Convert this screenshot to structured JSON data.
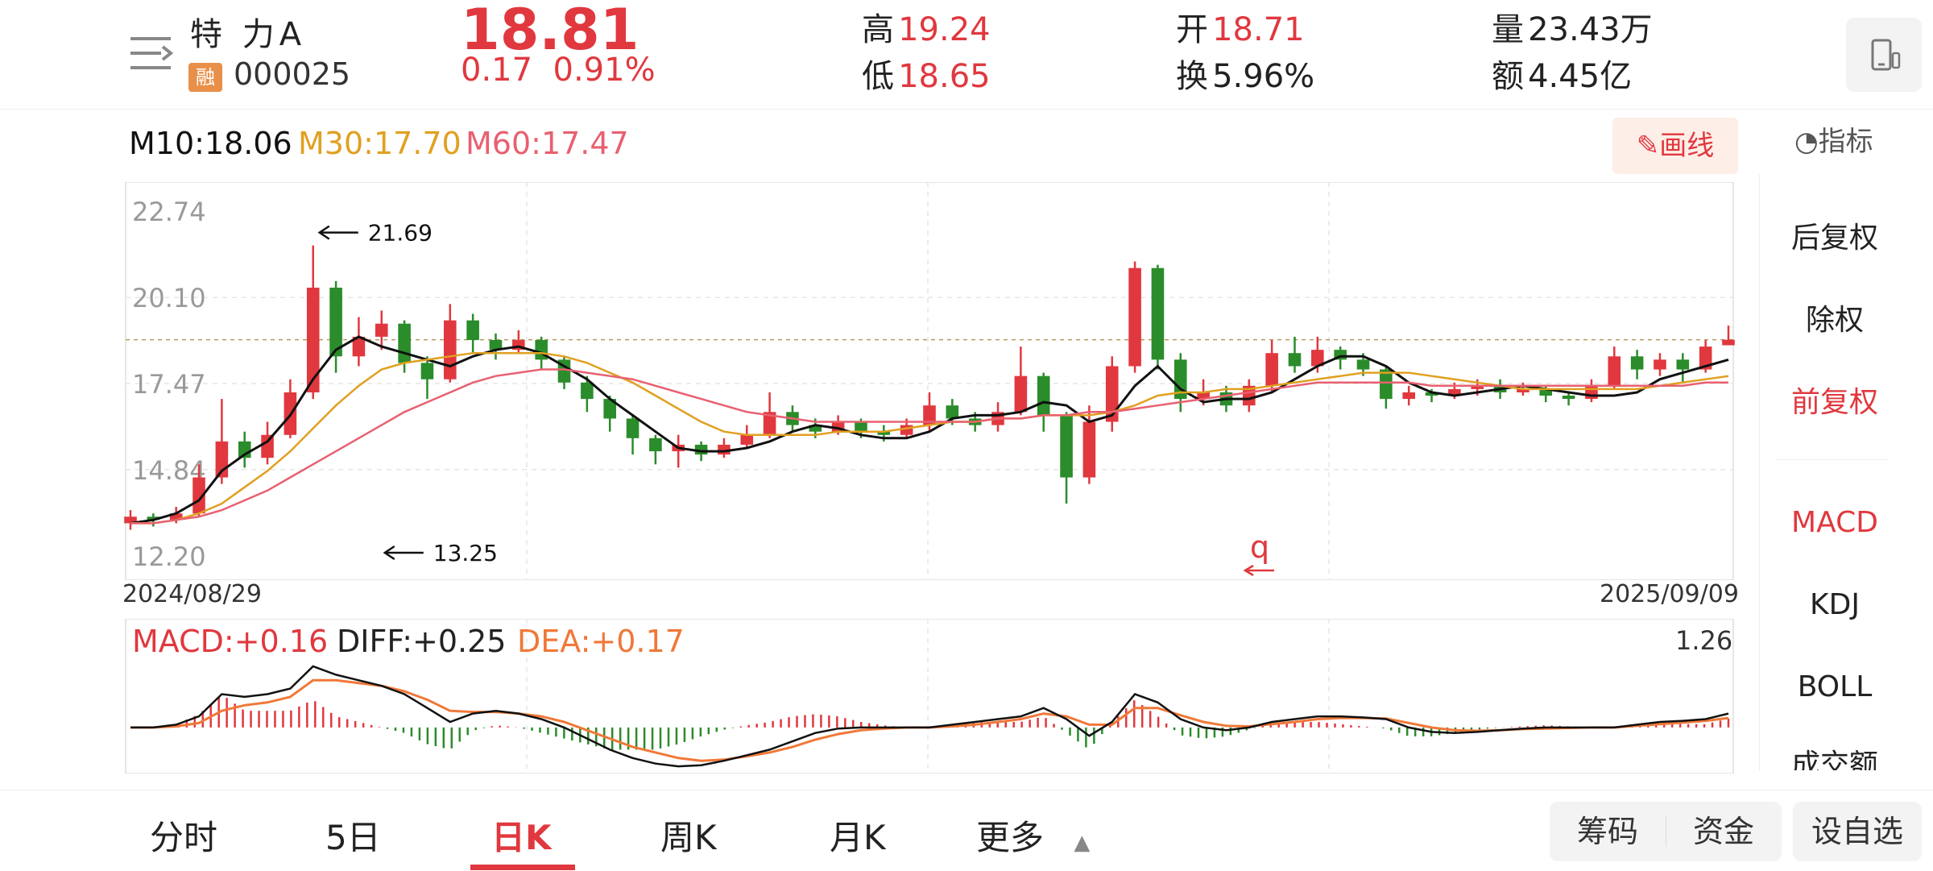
{
  "header": {
    "name": "特 力A",
    "rong_badge": "融",
    "code": "000025",
    "price": "18.81",
    "change": "0.17",
    "change_pct": "0.91%",
    "high_label": "高",
    "high": "19.24",
    "low_label": "低",
    "low": "18.65",
    "open_label": "开",
    "open": "18.71",
    "turnover_label": "换",
    "turnover": "5.96%",
    "volume_label": "量",
    "volume": "23.43万",
    "amount_label": "额",
    "amount": "4.45亿"
  },
  "ma_legend": {
    "m10": "M10:18.06",
    "m30": "M30:17.70",
    "m60": "M60:17.47"
  },
  "toolbar": {
    "draw_label": "画线",
    "indicator_label": "指标"
  },
  "right_panel": {
    "items": [
      "后复权",
      "除权",
      "前复权",
      "MACD",
      "KDJ",
      "BOLL",
      "成交额"
    ]
  },
  "macd_legend": {
    "macd": "MACD:+0.16",
    "diff": "DIFF:+0.25",
    "dea": "DEA:+0.17",
    "axis_max": "1.26"
  },
  "dates": {
    "start": "2024/08/29",
    "end": "2025/09/09"
  },
  "annotation_q": "q",
  "tabs": [
    "分时",
    "5日",
    "日K",
    "周K",
    "月K",
    "更多"
  ],
  "active_tab": "日K",
  "pills": {
    "chips": "筹码",
    "funds": "资金",
    "add_watch": "设自选"
  },
  "colors": {
    "up": "#e0383e",
    "down": "#2a8c2a",
    "m10": "#111111",
    "m30": "#e0a020",
    "m60": "#e86070",
    "dea": "#f07838"
  },
  "chart_data": {
    "type": "candlestick",
    "ylim": [
      12.2,
      22.74
    ],
    "y_ticks": [
      "22.74",
      "20.10",
      "17.47",
      "14.84",
      "12.20"
    ],
    "max_marker": "21.69",
    "min_marker": "13.25",
    "current_price": 18.81,
    "series": [
      {
        "name": "M10",
        "values": [
          13.2,
          13.3,
          13.5,
          13.9,
          14.8,
          15.3,
          15.7,
          16.5,
          17.6,
          18.5,
          18.9,
          18.6,
          18.4,
          18.2,
          18.0,
          18.3,
          18.5,
          18.6,
          18.4,
          18.0,
          17.6,
          17.0,
          16.5,
          16.0,
          15.5,
          15.4,
          15.4,
          15.5,
          15.7,
          16.0,
          16.2,
          16.1,
          15.9,
          15.8,
          15.8,
          16.0,
          16.4,
          16.5,
          16.5,
          16.6,
          16.9,
          16.8,
          16.3,
          16.5,
          17.4,
          18.0,
          17.3,
          16.9,
          17.0,
          17.0,
          17.2,
          17.6,
          18.0,
          18.3,
          18.3,
          18.0,
          17.5,
          17.2,
          17.1,
          17.2,
          17.3,
          17.4,
          17.3,
          17.2,
          17.1,
          17.1,
          17.2,
          17.6,
          17.8,
          18.0,
          18.2
        ]
      },
      {
        "name": "M30",
        "values": [
          13.2,
          13.2,
          13.3,
          13.5,
          13.8,
          14.3,
          14.8,
          15.4,
          16.1,
          16.8,
          17.4,
          17.9,
          18.1,
          18.2,
          18.3,
          18.4,
          18.4,
          18.4,
          18.4,
          18.3,
          18.1,
          17.8,
          17.5,
          17.1,
          16.7,
          16.3,
          16.0,
          15.9,
          15.9,
          15.9,
          15.9,
          16.0,
          16.0,
          16.0,
          16.1,
          16.2,
          16.3,
          16.3,
          16.4,
          16.4,
          16.5,
          16.5,
          16.5,
          16.6,
          16.8,
          17.1,
          17.2,
          17.2,
          17.3,
          17.3,
          17.4,
          17.5,
          17.6,
          17.7,
          17.8,
          17.8,
          17.8,
          17.7,
          17.6,
          17.5,
          17.4,
          17.3,
          17.3,
          17.3,
          17.3,
          17.3,
          17.3,
          17.4,
          17.5,
          17.6,
          17.7
        ]
      },
      {
        "name": "M60",
        "values": [
          13.2,
          13.2,
          13.3,
          13.4,
          13.6,
          13.9,
          14.2,
          14.6,
          15.0,
          15.4,
          15.8,
          16.2,
          16.6,
          16.9,
          17.2,
          17.5,
          17.7,
          17.8,
          17.9,
          17.9,
          17.8,
          17.7,
          17.6,
          17.4,
          17.2,
          17.0,
          16.8,
          16.6,
          16.5,
          16.4,
          16.3,
          16.3,
          16.3,
          16.3,
          16.3,
          16.3,
          16.3,
          16.3,
          16.4,
          16.4,
          16.5,
          16.5,
          16.6,
          16.6,
          16.7,
          16.8,
          16.9,
          17.0,
          17.1,
          17.2,
          17.3,
          17.4,
          17.5,
          17.5,
          17.5,
          17.5,
          17.5,
          17.4,
          17.4,
          17.4,
          17.4,
          17.4,
          17.4,
          17.4,
          17.4,
          17.4,
          17.4,
          17.4,
          17.4,
          17.5,
          17.5
        ]
      }
    ],
    "candles": [
      {
        "o": 13.2,
        "c": 13.4,
        "h": 13.6,
        "l": 13.0
      },
      {
        "o": 13.4,
        "c": 13.3,
        "h": 13.5,
        "l": 13.1
      },
      {
        "o": 13.3,
        "c": 13.5,
        "h": 13.7,
        "l": 13.2
      },
      {
        "o": 13.5,
        "c": 14.6,
        "h": 15.0,
        "l": 13.4
      },
      {
        "o": 14.6,
        "c": 15.7,
        "h": 17.0,
        "l": 14.4
      },
      {
        "o": 15.7,
        "c": 15.2,
        "h": 16.0,
        "l": 14.9
      },
      {
        "o": 15.2,
        "c": 15.9,
        "h": 16.3,
        "l": 15.0
      },
      {
        "o": 15.9,
        "c": 17.2,
        "h": 17.6,
        "l": 15.8
      },
      {
        "o": 17.2,
        "c": 20.4,
        "h": 21.69,
        "l": 17.0
      },
      {
        "o": 20.4,
        "c": 18.3,
        "h": 20.6,
        "l": 17.8
      },
      {
        "o": 18.3,
        "c": 18.9,
        "h": 19.5,
        "l": 18.0
      },
      {
        "o": 18.9,
        "c": 19.3,
        "h": 19.7,
        "l": 18.5
      },
      {
        "o": 19.3,
        "c": 18.1,
        "h": 19.4,
        "l": 17.8
      },
      {
        "o": 18.1,
        "c": 17.6,
        "h": 18.3,
        "l": 17.0
      },
      {
        "o": 17.6,
        "c": 19.4,
        "h": 19.9,
        "l": 17.5
      },
      {
        "o": 19.4,
        "c": 18.8,
        "h": 19.6,
        "l": 18.4
      },
      {
        "o": 18.8,
        "c": 18.5,
        "h": 19.0,
        "l": 18.2
      },
      {
        "o": 18.5,
        "c": 18.8,
        "h": 19.1,
        "l": 18.4
      },
      {
        "o": 18.8,
        "c": 18.2,
        "h": 18.9,
        "l": 17.9
      },
      {
        "o": 18.2,
        "c": 17.5,
        "h": 18.3,
        "l": 17.3
      },
      {
        "o": 17.5,
        "c": 17.0,
        "h": 17.7,
        "l": 16.6
      },
      {
        "o": 17.0,
        "c": 16.4,
        "h": 17.1,
        "l": 16.0
      },
      {
        "o": 16.4,
        "c": 15.8,
        "h": 16.5,
        "l": 15.3
      },
      {
        "o": 15.8,
        "c": 15.4,
        "h": 15.9,
        "l": 15.0
      },
      {
        "o": 15.4,
        "c": 15.6,
        "h": 15.9,
        "l": 14.9
      },
      {
        "o": 15.6,
        "c": 15.3,
        "h": 15.7,
        "l": 15.1
      },
      {
        "o": 15.3,
        "c": 15.6,
        "h": 15.8,
        "l": 15.2
      },
      {
        "o": 15.6,
        "c": 15.9,
        "h": 16.2,
        "l": 15.5
      },
      {
        "o": 15.9,
        "c": 16.6,
        "h": 17.2,
        "l": 15.8
      },
      {
        "o": 16.6,
        "c": 16.2,
        "h": 16.8,
        "l": 16.0
      },
      {
        "o": 16.2,
        "c": 16.0,
        "h": 16.4,
        "l": 15.8
      },
      {
        "o": 16.0,
        "c": 16.3,
        "h": 16.5,
        "l": 15.9
      },
      {
        "o": 16.3,
        "c": 16.0,
        "h": 16.4,
        "l": 15.8
      },
      {
        "o": 16.0,
        "c": 15.9,
        "h": 16.2,
        "l": 15.7
      },
      {
        "o": 15.9,
        "c": 16.2,
        "h": 16.4,
        "l": 15.8
      },
      {
        "o": 16.2,
        "c": 16.8,
        "h": 17.2,
        "l": 16.0
      },
      {
        "o": 16.8,
        "c": 16.4,
        "h": 17.0,
        "l": 16.2
      },
      {
        "o": 16.4,
        "c": 16.2,
        "h": 16.6,
        "l": 16.0
      },
      {
        "o": 16.2,
        "c": 16.6,
        "h": 16.9,
        "l": 16.0
      },
      {
        "o": 16.6,
        "c": 17.7,
        "h": 18.6,
        "l": 16.5
      },
      {
        "o": 17.7,
        "c": 16.5,
        "h": 17.8,
        "l": 16.0
      },
      {
        "o": 16.5,
        "c": 14.6,
        "h": 16.6,
        "l": 13.8
      },
      {
        "o": 14.6,
        "c": 16.3,
        "h": 16.8,
        "l": 14.4
      },
      {
        "o": 16.3,
        "c": 18.0,
        "h": 18.3,
        "l": 16.0
      },
      {
        "o": 18.0,
        "c": 21.0,
        "h": 21.2,
        "l": 17.8
      },
      {
        "o": 21.0,
        "c": 18.2,
        "h": 21.1,
        "l": 17.9
      },
      {
        "o": 18.2,
        "c": 17.0,
        "h": 18.4,
        "l": 16.6
      },
      {
        "o": 17.0,
        "c": 17.2,
        "h": 17.6,
        "l": 16.8
      },
      {
        "o": 17.2,
        "c": 16.8,
        "h": 17.4,
        "l": 16.6
      },
      {
        "o": 16.8,
        "c": 17.4,
        "h": 17.6,
        "l": 16.6
      },
      {
        "o": 17.4,
        "c": 18.4,
        "h": 18.8,
        "l": 17.2
      },
      {
        "o": 18.4,
        "c": 18.0,
        "h": 18.9,
        "l": 17.8
      },
      {
        "o": 18.0,
        "c": 18.5,
        "h": 18.9,
        "l": 17.8
      },
      {
        "o": 18.5,
        "c": 18.2,
        "h": 18.6,
        "l": 17.9
      },
      {
        "o": 18.2,
        "c": 17.9,
        "h": 18.4,
        "l": 17.7
      },
      {
        "o": 17.9,
        "c": 17.0,
        "h": 18.0,
        "l": 16.7
      },
      {
        "o": 17.0,
        "c": 17.2,
        "h": 17.4,
        "l": 16.8
      },
      {
        "o": 17.2,
        "c": 17.1,
        "h": 17.3,
        "l": 16.9
      },
      {
        "o": 17.1,
        "c": 17.3,
        "h": 17.5,
        "l": 17.0
      },
      {
        "o": 17.3,
        "c": 17.4,
        "h": 17.6,
        "l": 17.1
      },
      {
        "o": 17.4,
        "c": 17.2,
        "h": 17.6,
        "l": 17.0
      },
      {
        "o": 17.2,
        "c": 17.3,
        "h": 17.5,
        "l": 17.1
      },
      {
        "o": 17.3,
        "c": 17.1,
        "h": 17.4,
        "l": 16.9
      },
      {
        "o": 17.1,
        "c": 17.0,
        "h": 17.2,
        "l": 16.8
      },
      {
        "o": 17.0,
        "c": 17.4,
        "h": 17.6,
        "l": 16.9
      },
      {
        "o": 17.4,
        "c": 18.3,
        "h": 18.6,
        "l": 17.3
      },
      {
        "o": 18.3,
        "c": 17.9,
        "h": 18.5,
        "l": 17.6
      },
      {
        "o": 17.9,
        "c": 18.2,
        "h": 18.4,
        "l": 17.7
      },
      {
        "o": 18.2,
        "c": 17.9,
        "h": 18.4,
        "l": 17.5
      },
      {
        "o": 17.9,
        "c": 18.6,
        "h": 18.8,
        "l": 17.8
      },
      {
        "o": 18.64,
        "c": 18.81,
        "h": 19.24,
        "l": 18.65
      }
    ],
    "macd": {
      "diff": [
        0.0,
        0.0,
        0.05,
        0.2,
        0.6,
        0.55,
        0.6,
        0.7,
        1.1,
        0.95,
        0.85,
        0.75,
        0.6,
        0.35,
        0.1,
        0.25,
        0.3,
        0.25,
        0.15,
        0.0,
        -0.2,
        -0.4,
        -0.55,
        -0.65,
        -0.7,
        -0.68,
        -0.6,
        -0.5,
        -0.4,
        -0.25,
        -0.1,
        -0.02,
        0.0,
        0.0,
        0.0,
        0.0,
        0.05,
        0.1,
        0.15,
        0.2,
        0.35,
        0.15,
        -0.15,
        0.1,
        0.6,
        0.45,
        0.15,
        0.0,
        -0.05,
        0.0,
        0.1,
        0.15,
        0.2,
        0.2,
        0.18,
        0.15,
        0.0,
        -0.08,
        -0.1,
        -0.08,
        -0.05,
        -0.02,
        0.0,
        0.0,
        0.0,
        0.0,
        0.05,
        0.1,
        0.12,
        0.15,
        0.25
      ],
      "dea": [
        0.0,
        0.0,
        0.02,
        0.08,
        0.3,
        0.4,
        0.45,
        0.55,
        0.85,
        0.85,
        0.8,
        0.75,
        0.65,
        0.5,
        0.3,
        0.28,
        0.28,
        0.25,
        0.2,
        0.1,
        -0.05,
        -0.2,
        -0.35,
        -0.45,
        -0.55,
        -0.6,
        -0.58,
        -0.52,
        -0.45,
        -0.35,
        -0.22,
        -0.12,
        -0.05,
        -0.02,
        0.0,
        0.0,
        0.02,
        0.05,
        0.1,
        0.15,
        0.25,
        0.2,
        0.05,
        0.05,
        0.35,
        0.35,
        0.22,
        0.1,
        0.03,
        0.02,
        0.06,
        0.1,
        0.15,
        0.17,
        0.17,
        0.16,
        0.08,
        0.0,
        -0.05,
        -0.06,
        -0.05,
        -0.03,
        -0.02,
        -0.01,
        0.0,
        0.0,
        0.03,
        0.06,
        0.09,
        0.12,
        0.17
      ],
      "range": [
        -0.8,
        1.26
      ]
    }
  }
}
